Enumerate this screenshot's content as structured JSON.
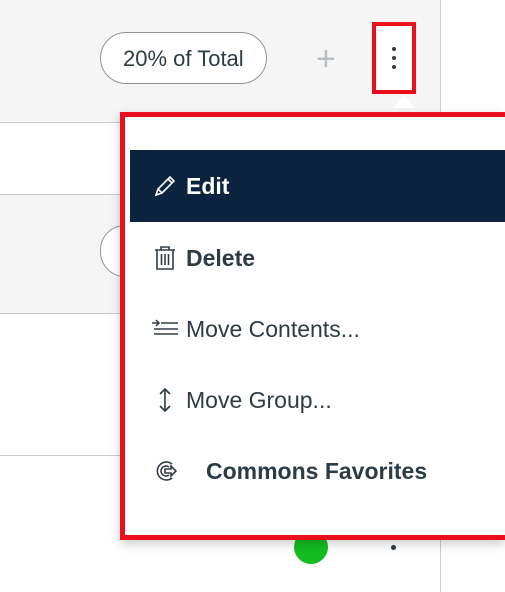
{
  "assignment_group": {
    "weight_label": "20% of Total"
  },
  "menu": {
    "items": [
      {
        "label": "Edit",
        "icon": "pencil-icon",
        "active": true
      },
      {
        "label": "Delete",
        "icon": "trash-icon",
        "active": false
      },
      {
        "label": "Move Contents...",
        "icon": "move-contents-icon",
        "active": false
      },
      {
        "label": "Move Group...",
        "icon": "move-vertical-icon",
        "active": false
      },
      {
        "label": "Commons Favorites",
        "icon": "commons-share-icon",
        "active": false
      }
    ]
  },
  "colors": {
    "highlight_border": "#e8111b",
    "active_item_bg": "#0c2340",
    "text": "#2d3b45",
    "published_status": "#13bd20"
  }
}
